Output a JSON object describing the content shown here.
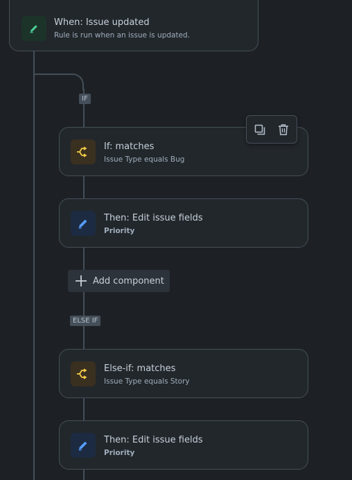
{
  "trigger": {
    "icon": "pencil-icon",
    "title": "When: Issue updated",
    "subtitle": "Rule is run when an issue is updated."
  },
  "branch": {
    "if_label": "IF",
    "else_if_label": "ELSE IF"
  },
  "condition_if": {
    "icon": "branch-condition-icon",
    "title": "If: matches",
    "subtitle": "Issue Type equals Bug"
  },
  "action_1": {
    "icon": "pencil-icon",
    "title": "Then: Edit issue fields",
    "subtitle": "Priority"
  },
  "add_component": {
    "icon": "plus-icon",
    "label": "Add component"
  },
  "condition_else_if": {
    "icon": "branch-condition-icon",
    "title": "Else-if: matches",
    "subtitle": "Issue Type equals Story"
  },
  "action_2": {
    "icon": "pencil-icon",
    "title": "Then: Edit issue fields",
    "subtitle": "Priority"
  },
  "card_toolbar": {
    "copy_icon": "copy-icon",
    "delete_icon": "trash-icon"
  },
  "colors": {
    "background": "#1d2125",
    "card": "#22272b",
    "border": "#454f59",
    "trigger_icon_bg": "#1c3329",
    "trigger_icon": "#4bce97",
    "condition_icon_bg": "#3a3020",
    "condition_icon": "#f5cd47",
    "action_icon_bg": "#1c2b41",
    "action_icon": "#579dff"
  }
}
